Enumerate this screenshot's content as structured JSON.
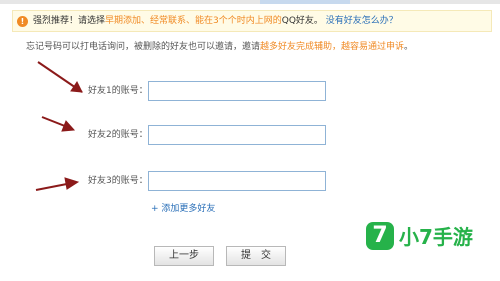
{
  "notice": {
    "prefix": "强烈推荐！请选择",
    "highlight": "早期添加、经常联系、能在3个个时内上网的",
    "suffix": "QQ好友。",
    "link": "没有好友怎么办？"
  },
  "description": {
    "text": "忘记号码可以打电话询问，被删除的好友也可以邀请，邀请",
    "highlight": "越多好友完成辅助，越容易通过申诉",
    "end": "。"
  },
  "form": {
    "friends": [
      {
        "label": "好友1的账号：",
        "value": ""
      },
      {
        "label": "好友2的账号：",
        "value": ""
      },
      {
        "label": "好友3的账号：",
        "value": ""
      }
    ],
    "add_more": "+ 添加更多好友"
  },
  "buttons": {
    "prev": "上一步",
    "submit": "提　交"
  },
  "watermark": {
    "badge": "7",
    "text": "小7手游",
    "color": "#26b24a"
  },
  "colors": {
    "highlight": "#f08a24",
    "link": "#2a6fb8",
    "arrow": "#8b1a1a"
  }
}
